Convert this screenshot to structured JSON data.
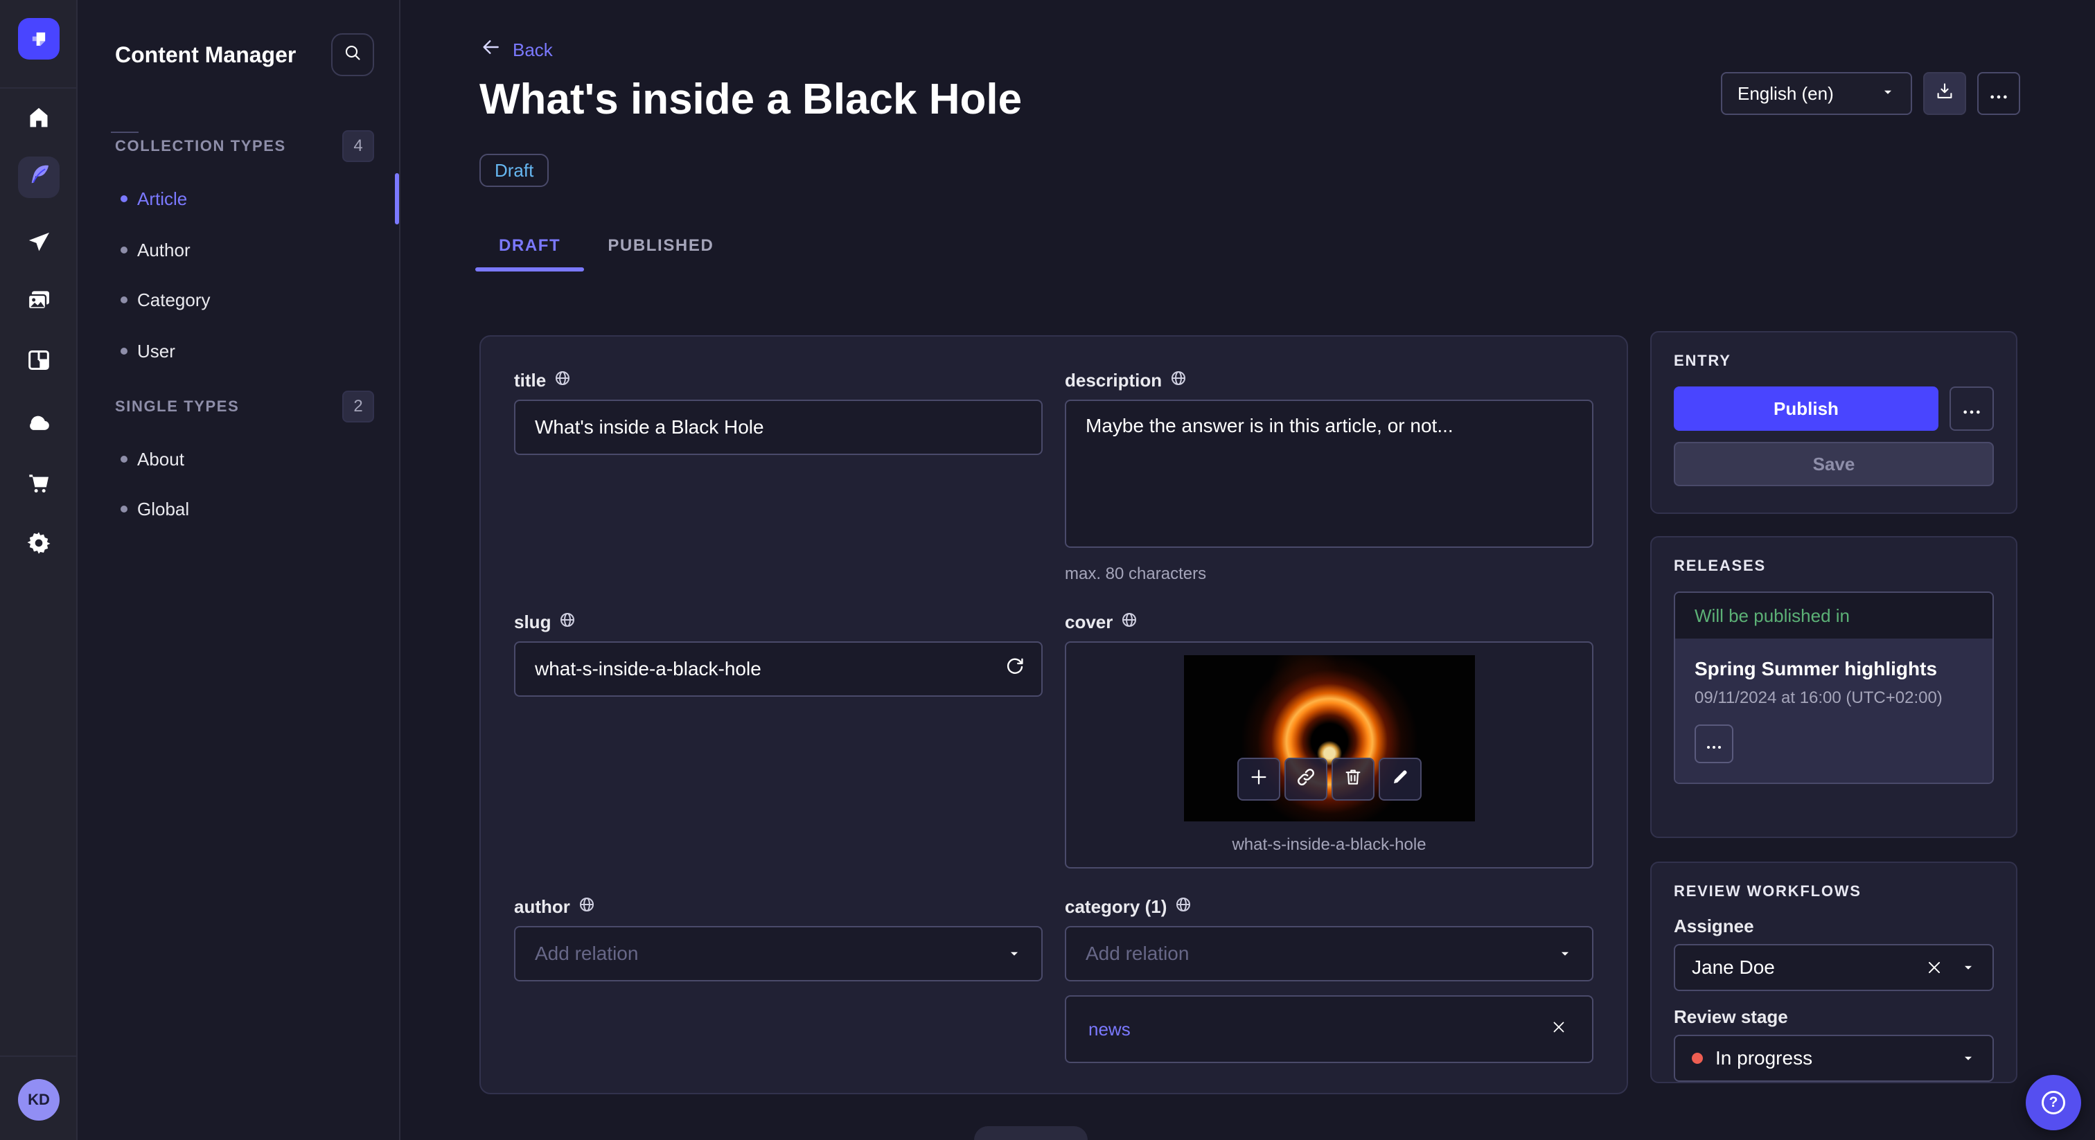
{
  "colors": {
    "accent": "#4945ff",
    "accent_light": "#7b79ff",
    "draft_blue": "#66b7f1",
    "success_green": "#5cb176",
    "danger_red": "#ee5e52",
    "page_bg": "#181826",
    "card_bg": "#212134"
  },
  "rail": {
    "avatar_initials": "KD"
  },
  "sidebar": {
    "title": "Content Manager",
    "sections": [
      {
        "label": "COLLECTION TYPES",
        "count": "4",
        "items": [
          {
            "label": "Article"
          },
          {
            "label": "Author"
          },
          {
            "label": "Category"
          },
          {
            "label": "User"
          }
        ]
      },
      {
        "label": "SINGLE TYPES",
        "count": "2",
        "items": [
          {
            "label": "About"
          },
          {
            "label": "Global"
          }
        ]
      }
    ]
  },
  "header": {
    "back_label": "Back",
    "title": "What's inside a Black Hole",
    "status_badge": "Draft",
    "locale": "English (en)"
  },
  "tabs": {
    "draft": "DRAFT",
    "published": "PUBLISHED"
  },
  "form": {
    "title": {
      "label": "title",
      "value": "What's inside a Black Hole"
    },
    "description": {
      "label": "description",
      "value": "Maybe the answer is in this article, or not...",
      "hint": "max. 80 characters"
    },
    "slug": {
      "label": "slug",
      "value": "what-s-inside-a-black-hole"
    },
    "cover": {
      "label": "cover",
      "caption": "what-s-inside-a-black-hole"
    },
    "author": {
      "label": "author",
      "placeholder": "Add relation"
    },
    "category": {
      "label": "category (1)",
      "placeholder": "Add relation",
      "relations": [
        {
          "label": "news"
        }
      ]
    }
  },
  "entry_panel": {
    "heading": "ENTRY",
    "publish_label": "Publish",
    "save_label": "Save"
  },
  "releases_panel": {
    "heading": "RELEASES",
    "status": "Will be published in",
    "release_title": "Spring Summer highlights",
    "release_date": "09/11/2024 at 16:00 (UTC+02:00)"
  },
  "review_panel": {
    "heading": "REVIEW WORKFLOWS",
    "assignee_label": "Assignee",
    "assignee_value": "Jane Doe",
    "stage_label": "Review stage",
    "stage_value": "In progress"
  }
}
